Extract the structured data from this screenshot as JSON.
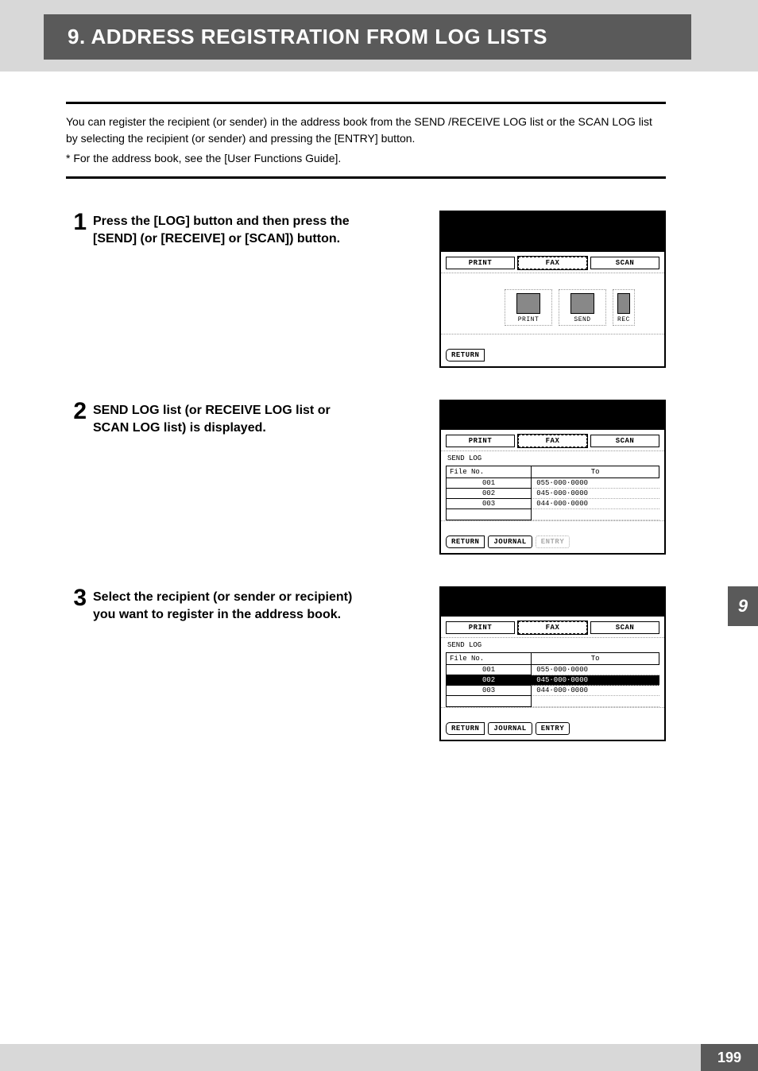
{
  "header": {
    "title": "9. ADDRESS REGISTRATION FROM LOG LISTS"
  },
  "intro_text": "You can register the recipient (or sender) in the address book from the SEND /RECEIVE LOG list or the SCAN LOG list by selecting the recipient (or sender) and pressing the [ENTRY] button.",
  "footnote_text": "*  For the address book, see the [User Functions Guide].",
  "steps": [
    {
      "num": "1",
      "text": "Press the [LOG] button and then press the [SEND] (or [RECEIVE] or [SCAN]) button."
    },
    {
      "num": "2",
      "text": "SEND LOG list (or RECEIVE LOG list or SCAN LOG list) is displayed."
    },
    {
      "num": "3",
      "text": "Select the recipient (or sender or recipient) you want to register in the address book."
    }
  ],
  "screens": {
    "tabs": {
      "print": "PRINT",
      "fax": "FAX",
      "scan": "SCAN"
    },
    "iconrow": {
      "print": "PRINT",
      "send": "SEND",
      "rec": "REC"
    },
    "return_btn": "RETURN",
    "journal_btn": "JOURNAL",
    "entry_btn": "ENTRY",
    "log_title": "SEND LOG",
    "columns": {
      "fileno": "File No.",
      "to": "To"
    },
    "rows": [
      {
        "file": "001",
        "to": "055·000·0000"
      },
      {
        "file": "002",
        "to": "045·000·0000"
      },
      {
        "file": "003",
        "to": "044·000·0000"
      }
    ],
    "screen3_selected_index": 1
  },
  "side_tab": "9",
  "page_number": "199"
}
